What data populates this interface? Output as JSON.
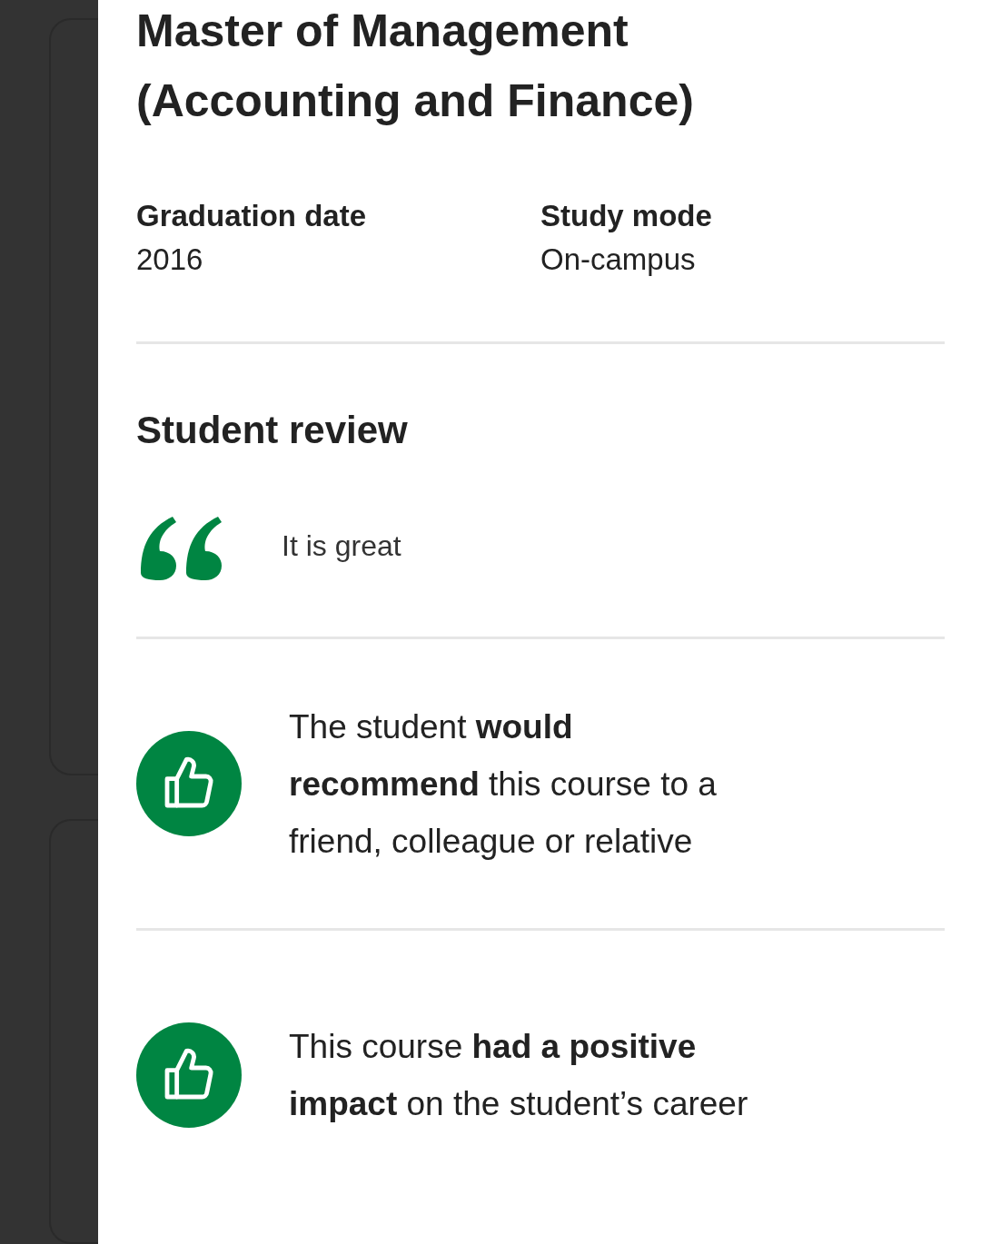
{
  "course": {
    "title": "Master of Management (Accounting and Finance)"
  },
  "details": [
    {
      "label": "Graduation date",
      "value": "2016"
    },
    {
      "label": "Study mode",
      "value": "On-campus"
    }
  ],
  "review": {
    "heading": "Student review",
    "quote": "It is great",
    "points": [
      {
        "kind": "thumbs-up",
        "text": "The student **would recommend** this course to a friend, colleague or relative"
      },
      {
        "kind": "thumbs-up",
        "text": "This course **had a positive impact** on the student’s career"
      }
    ]
  }
}
